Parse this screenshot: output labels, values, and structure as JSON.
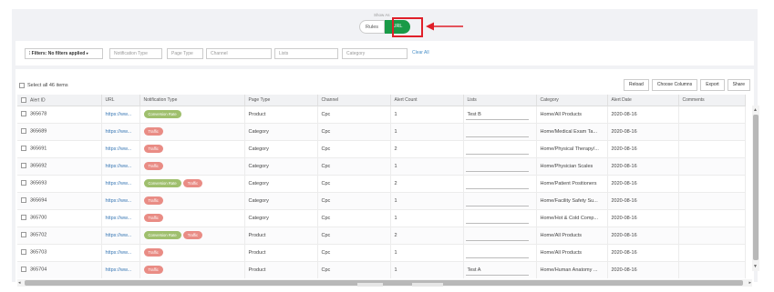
{
  "view_toggle": {
    "caption": "Show As",
    "rules_label": "Rules",
    "url_label": "URL",
    "active": "URL",
    "accent": "#1a9a47",
    "highlight_color": "#e0202a"
  },
  "filters": {
    "filter_dropdown_label": "Filters: No filters applied",
    "notification_type_placeholder": "Notification Type",
    "page_type_placeholder": "Page Type",
    "channel_placeholder": "Channel",
    "lists_placeholder": "Lists",
    "category_placeholder": "Category",
    "clear_all": "Clear All"
  },
  "grid": {
    "select_all_label": "Select all 46 items",
    "toolbar": {
      "reload": "Reload",
      "choose_columns": "Choose Columns",
      "export": "Export",
      "share": "Share"
    },
    "columns": [
      "Alert ID",
      "URL",
      "Notification Type",
      "Page Type",
      "Channel",
      "Alert Count",
      "Lists",
      "Category",
      "Alert Date",
      "Comments"
    ],
    "rows": [
      {
        "alert_id": "365678",
        "url": "https://ww...",
        "conv": "Conversion Rate",
        "traffic": "",
        "page_type": "Product",
        "channel": "Cpc",
        "count": "1",
        "lists": "Test B",
        "category": "Home/All Products",
        "date": "2020-08-16",
        "comments": ""
      },
      {
        "alert_id": "365689",
        "url": "https://ww...",
        "conv": "",
        "traffic": "Traffic",
        "page_type": "Category",
        "channel": "Cpc",
        "count": "1",
        "lists": "",
        "category": "Home/Medical Exam Ta...",
        "date": "2020-08-16",
        "comments": ""
      },
      {
        "alert_id": "365691",
        "url": "https://ww...",
        "conv": "",
        "traffic": "Traffic",
        "page_type": "Category",
        "channel": "Cpc",
        "count": "2",
        "lists": "",
        "category": "Home/Physical Therapy/...",
        "date": "2020-08-16",
        "comments": ""
      },
      {
        "alert_id": "365692",
        "url": "https://ww...",
        "conv": "",
        "traffic": "Traffic",
        "page_type": "Category",
        "channel": "Cpc",
        "count": "1",
        "lists": "",
        "category": "Home/Physician Scales",
        "date": "2020-08-16",
        "comments": ""
      },
      {
        "alert_id": "365693",
        "url": "https://ww...",
        "conv": "Conversion Rate",
        "traffic": "Traffic",
        "page_type": "Category",
        "channel": "Cpc",
        "count": "2",
        "lists": "",
        "category": "Home/Patient Positioners",
        "date": "2020-08-16",
        "comments": ""
      },
      {
        "alert_id": "365694",
        "url": "https://ww...",
        "conv": "",
        "traffic": "Traffic",
        "page_type": "Category",
        "channel": "Cpc",
        "count": "1",
        "lists": "",
        "category": "Home/Facility Safety Su...",
        "date": "2020-08-16",
        "comments": ""
      },
      {
        "alert_id": "365700",
        "url": "https://ww...",
        "conv": "",
        "traffic": "Traffic",
        "page_type": "Category",
        "channel": "Cpc",
        "count": "1",
        "lists": "",
        "category": "Home/Hot & Cold Comp...",
        "date": "2020-08-16",
        "comments": ""
      },
      {
        "alert_id": "365702",
        "url": "https://ww...",
        "conv": "Conversion Rate",
        "traffic": "Traffic",
        "page_type": "Product",
        "channel": "Cpc",
        "count": "2",
        "lists": "",
        "category": "Home/All Products",
        "date": "2020-08-16",
        "comments": ""
      },
      {
        "alert_id": "365703",
        "url": "https://ww...",
        "conv": "",
        "traffic": "Traffic",
        "page_type": "Product",
        "channel": "Cpc",
        "count": "1",
        "lists": "",
        "category": "Home/All Products",
        "date": "2020-08-16",
        "comments": ""
      },
      {
        "alert_id": "365704",
        "url": "https://ww...",
        "conv": "",
        "traffic": "Traffic",
        "page_type": "Product",
        "channel": "Cpc",
        "count": "1",
        "lists": "Test A",
        "category": "Home/Human Anatomy ...",
        "date": "2020-08-16",
        "comments": ""
      }
    ],
    "pill_colors": {
      "conversion_rate": "#9fbf6d",
      "traffic": "#e98c85"
    },
    "link_color": "#3a78b5"
  }
}
